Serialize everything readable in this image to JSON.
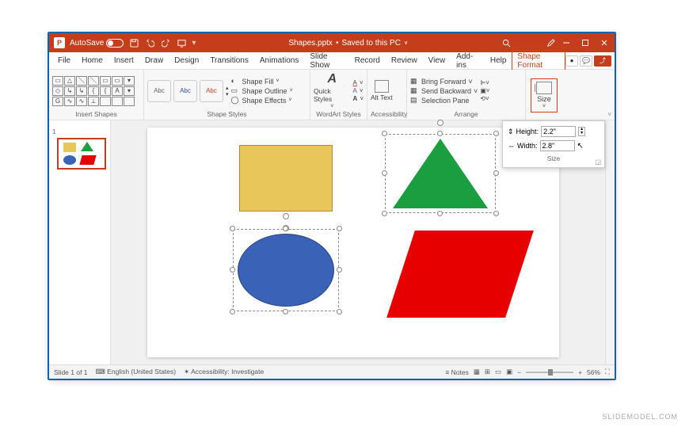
{
  "titlebar": {
    "autosave": "AutoSave",
    "filename": "Shapes.pptx",
    "saved": "Saved to this PC"
  },
  "menu": {
    "items": [
      "File",
      "Home",
      "Insert",
      "Draw",
      "Design",
      "Transitions",
      "Animations",
      "Slide Show",
      "Record",
      "Review",
      "View",
      "Add-ins",
      "Help",
      "Shape Format"
    ]
  },
  "ribbon": {
    "groups": {
      "insert_shapes": "Insert Shapes",
      "shape_styles": "Shape Styles",
      "wordart": "WordArt Styles",
      "accessibility": "Accessibility",
      "arrange": "Arrange",
      "size": "Size"
    },
    "shape_styles_sample": "Abc",
    "fill": "Shape Fill",
    "outline": "Shape Outline",
    "effects": "Shape Effects",
    "quick_styles": "Quick Styles",
    "alt_text": "Alt Text",
    "bring_forward": "Bring Forward",
    "send_backward": "Send Backward",
    "selection_pane": "Selection Pane",
    "size_label": "Size"
  },
  "size_popup": {
    "height_label": "Height:",
    "height_value": "2.2\"",
    "width_label": "Width:",
    "width_value": "2.8\"",
    "group_label": "Size"
  },
  "thumbnails": {
    "num": "1"
  },
  "status": {
    "slide": "Slide 1 of 1",
    "lang": "English (United States)",
    "accessibility": "Accessibility: Investigate",
    "notes": "Notes",
    "zoom": "56%"
  },
  "credit": "SLIDEMODEL.COM"
}
